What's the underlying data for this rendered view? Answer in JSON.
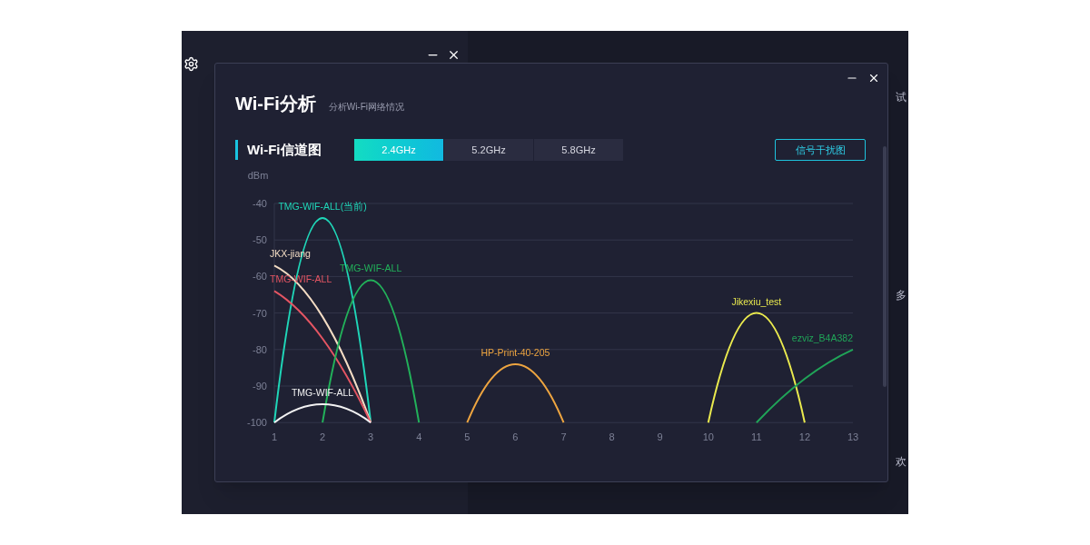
{
  "main_window": {
    "right_panel_texts": [
      "试",
      "多",
      "欢"
    ]
  },
  "dialog": {
    "title": "Wi-Fi分析",
    "subtitle": "分析Wi-Fi网络情况",
    "section_title": "Wi-Fi信道图",
    "tabs": [
      {
        "label": "2.4GHz",
        "selected": true
      },
      {
        "label": "5.2GHz",
        "selected": false
      },
      {
        "label": "5.8GHz",
        "selected": false
      }
    ],
    "interference_button": "信号干扰图",
    "chart_data": {
      "type": "line",
      "ylabel": "dBm",
      "x": [
        1,
        2,
        3,
        4,
        5,
        6,
        7,
        8,
        9,
        10,
        11,
        12,
        13
      ],
      "xlim": [
        1,
        13
      ],
      "grid": true,
      "ylim": [
        -100,
        -40
      ],
      "xticks": [
        1,
        2,
        3,
        4,
        5,
        6,
        7,
        8,
        9,
        10,
        11,
        12,
        13
      ],
      "yticks": [
        -40,
        -50,
        -60,
        -70,
        -80,
        -90,
        -100
      ],
      "series": [
        {
          "name": "TMG-WIF-ALL(当前)",
          "color": "#1fd6b8",
          "values": [
            -100,
            -44,
            -100,
            null,
            null,
            null,
            null,
            null,
            null,
            null,
            null,
            null,
            null
          ]
        },
        {
          "name": "JKX-jiang",
          "color": "#f3dcc4",
          "values": [
            -57,
            -71,
            -100,
            null,
            null,
            null,
            null,
            null,
            null,
            null,
            null,
            null,
            null
          ]
        },
        {
          "name": "TMG-WIF-ALL",
          "color": "#e45563",
          "values": [
            -64,
            -77,
            -100,
            null,
            null,
            null,
            null,
            null,
            null,
            null,
            null,
            null,
            null
          ]
        },
        {
          "name": "TMG-WIF-ALL",
          "color": "#22b15a",
          "values": [
            null,
            -100,
            -61,
            -100,
            null,
            null,
            null,
            null,
            null,
            null,
            null,
            null,
            null
          ]
        },
        {
          "name": "TMG-WIF-ALL",
          "color": "#f2f2f2",
          "values": [
            -100,
            -95,
            -100,
            null,
            null,
            null,
            null,
            null,
            null,
            null,
            null,
            null,
            null
          ]
        },
        {
          "name": "HP-Print-40-205",
          "color": "#eea540",
          "values": [
            null,
            null,
            null,
            null,
            -100,
            -84,
            -100,
            null,
            null,
            null,
            null,
            null,
            null
          ]
        },
        {
          "name": "Jikexiu_test",
          "color": "#eaea4e",
          "values": [
            null,
            null,
            null,
            null,
            null,
            null,
            null,
            null,
            null,
            -100,
            -70,
            -100,
            null
          ]
        },
        {
          "name": "ezviz_B4A382",
          "color": "#20a458",
          "values": [
            null,
            null,
            null,
            null,
            null,
            null,
            null,
            null,
            null,
            null,
            -100,
            -88,
            -80
          ]
        }
      ]
    }
  }
}
